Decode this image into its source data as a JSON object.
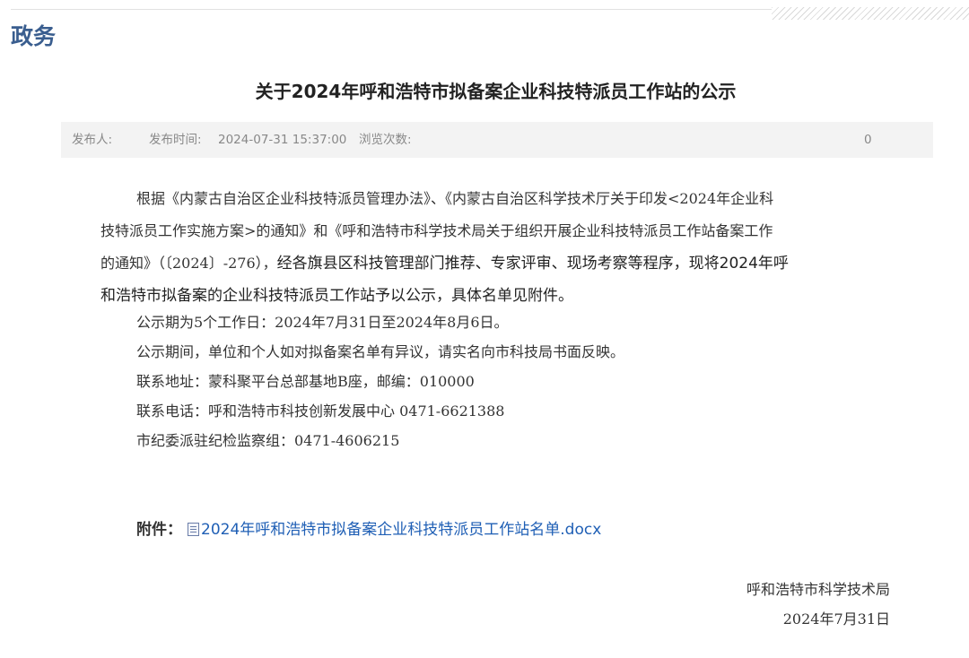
{
  "header": {
    "section_title": "政务"
  },
  "article": {
    "title": "关于2024年呼和浩特市拟备案企业科技特派员工作站的公示",
    "meta": {
      "publisher_label": "发布人:",
      "time_label": "发布时间:",
      "time_value": "2024-07-31 15:37:00",
      "views_label": "浏览次数:",
      "views_value": "0"
    },
    "paragraph1": {
      "line1": "根据《内蒙古自治区企业科技特派员管理办法》、《内蒙古自治区科学技术厅关于印发<2024年企业科",
      "line2": "技特派员工作实施方案>的通知》和《呼和浩特市科学技术局关于组织开展企业科技特派员工作站备案工作",
      "line3_serif": "的通知》（〔2024〕-276），",
      "line3_sans": "经各旗县区科技管理部门推荐、专家评审、现场考察等程序，现将2024年呼",
      "line4": "和浩特市拟备案的企业科技特派员工作站予以公示，具体名单见附件。"
    },
    "lines": {
      "period": "公示期为5个工作日：2024年7月31日至2024年8月6日。",
      "objection": "公示期间，单位和个人如对拟备案名单有异议，请实名向市科技局书面反映。",
      "address": "联系地址：蒙科聚平台总部基地B座，邮编：010000",
      "phone": "联系电话：呼和浩特市科技创新发展中心 0471-6621388",
      "discipline": "市纪委派驻纪检监察组：0471-4606215"
    },
    "attachment": {
      "label": "附件：",
      "file_name": "2024年呼和浩特市拟备案企业科技特派员工作站名单.docx",
      "icon": "word-document-icon"
    },
    "signature": {
      "org": "呼和浩特市科学技术局",
      "date": "2024年7月31日"
    }
  }
}
